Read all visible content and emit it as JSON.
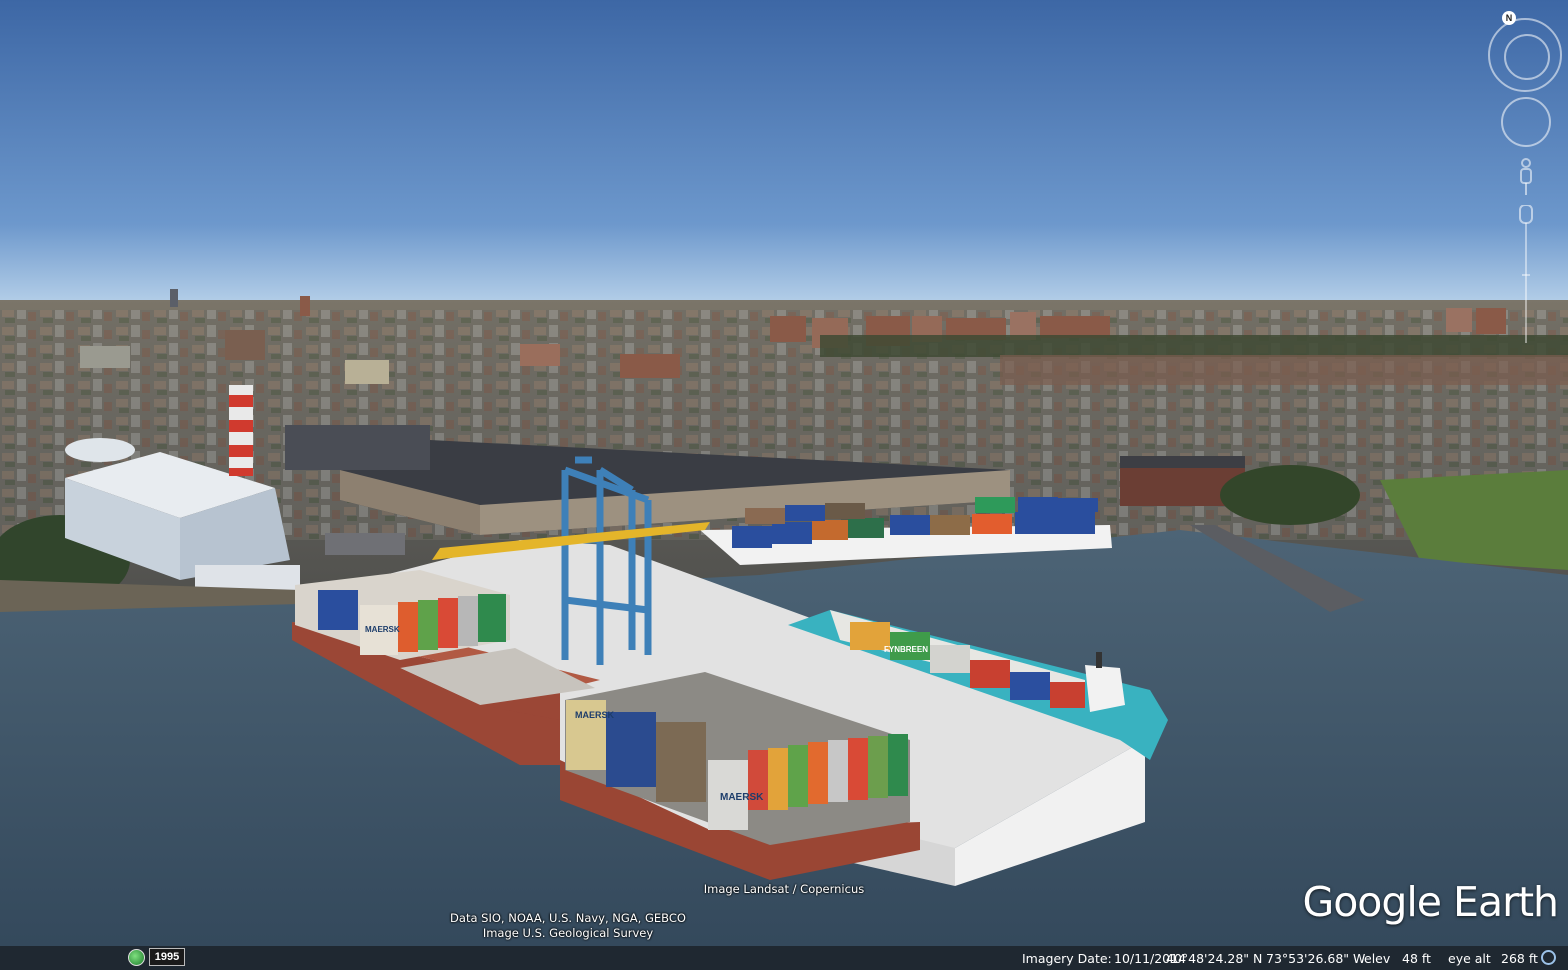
{
  "attribution": {
    "imagery": "Image Landsat / Copernicus",
    "data": "Data SIO, NOAA, U.S. Navy, NGA, GEBCO",
    "usgs": "Image U.S. Geological Survey"
  },
  "logo": "Google Earth",
  "nav": {
    "north_label": "N"
  },
  "status_bar": {
    "historical_year": "1995",
    "imagery_date_label": "Imagery Date:",
    "imagery_date": "10/11/2014",
    "latitude": "40°48'24.28\" N",
    "longitude": "73°53'26.68\" W",
    "elev_label": "elev",
    "elev_value": "48 ft",
    "eye_alt_label": "eye alt",
    "eye_alt_value": "268 ft"
  },
  "container_labels": {
    "maersk": "MAERSK",
    "hamburg": "FYNBREEN"
  },
  "colors": {
    "sky_top": "#3f6aa8",
    "sky_horizon": "#b8d4ec",
    "water": "#3d5468",
    "pier": "#e3e3e3",
    "barge_hull": "#a04a3a",
    "crane": "#3a7fb3",
    "ship_hull": "#3fb5c3"
  }
}
